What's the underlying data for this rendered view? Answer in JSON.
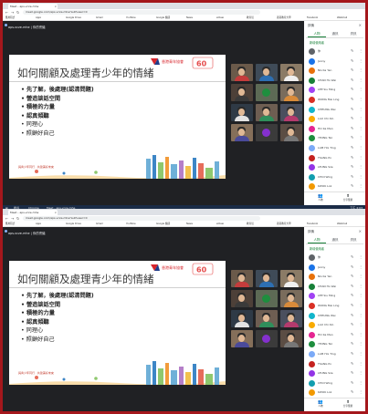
{
  "browser": {
    "tab_title": "Meet - aps-vcze-mhe",
    "tab_close": "×",
    "url": "meet.google.com/aps-vcze-mhe?authuser=0",
    "nav_back": "←",
    "nav_forward": "→",
    "nav_reload": "↻",
    "bookmarks": [
      "應用程式",
      "Apps",
      "Google Drive",
      "Gmail",
      "YouTube",
      "Google 翻譯",
      "News",
      "eClass",
      "教育局",
      "香港教育大學",
      "Facebook",
      "Webmail"
    ]
  },
  "meeting": {
    "code": "aps-vcze-mhe | 你的會議",
    "self_name": "你",
    "controls": [
      "🎤",
      "✆",
      "▭"
    ]
  },
  "slide": {
    "title": "如何關顧及處理青少年的情緒",
    "logo_text": "香港青年協會",
    "logo_badge": "60",
    "bullets": [
      "先了解，後處理(認清問題)",
      "營造談話空間",
      "積極的力量",
      "認真傾聽",
      "同理心",
      "照顧好自己"
    ],
    "slogan": "與青少年同行 · 共建美好未來"
  },
  "people_panel": {
    "header": "詳情",
    "close_icon": "×",
    "tabs": [
      "人物",
      "通訊",
      "資訊"
    ],
    "add_people": "新增使用者",
    "participants": [
      "你",
      "Janny",
      "NG Ka Yan",
      "CHAN Ho Wai",
      "LEE Siu Ming",
      "WONG Mei Ling",
      "CHEUNG Wai",
      "LAU Chi Kin",
      "HO Ka Man",
      "YEUNG Tsz",
      "LAM Hoi Ting",
      "TSANG Po",
      "LEUNG Sze",
      "CHOI Wing",
      "KWOK Lok"
    ],
    "footer": [
      "人物",
      "分享螢幕"
    ]
  },
  "taskbar": {
    "items": [
      "⊞",
      "搜尋",
      "Chrome",
      "Meet - aps-vcze-mhe"
    ],
    "clock": "下午 4:03"
  },
  "colors": {
    "frame": "#a4171c",
    "meet_bg": "#202124",
    "hangup": "#ea4335",
    "accent": "#188038"
  }
}
